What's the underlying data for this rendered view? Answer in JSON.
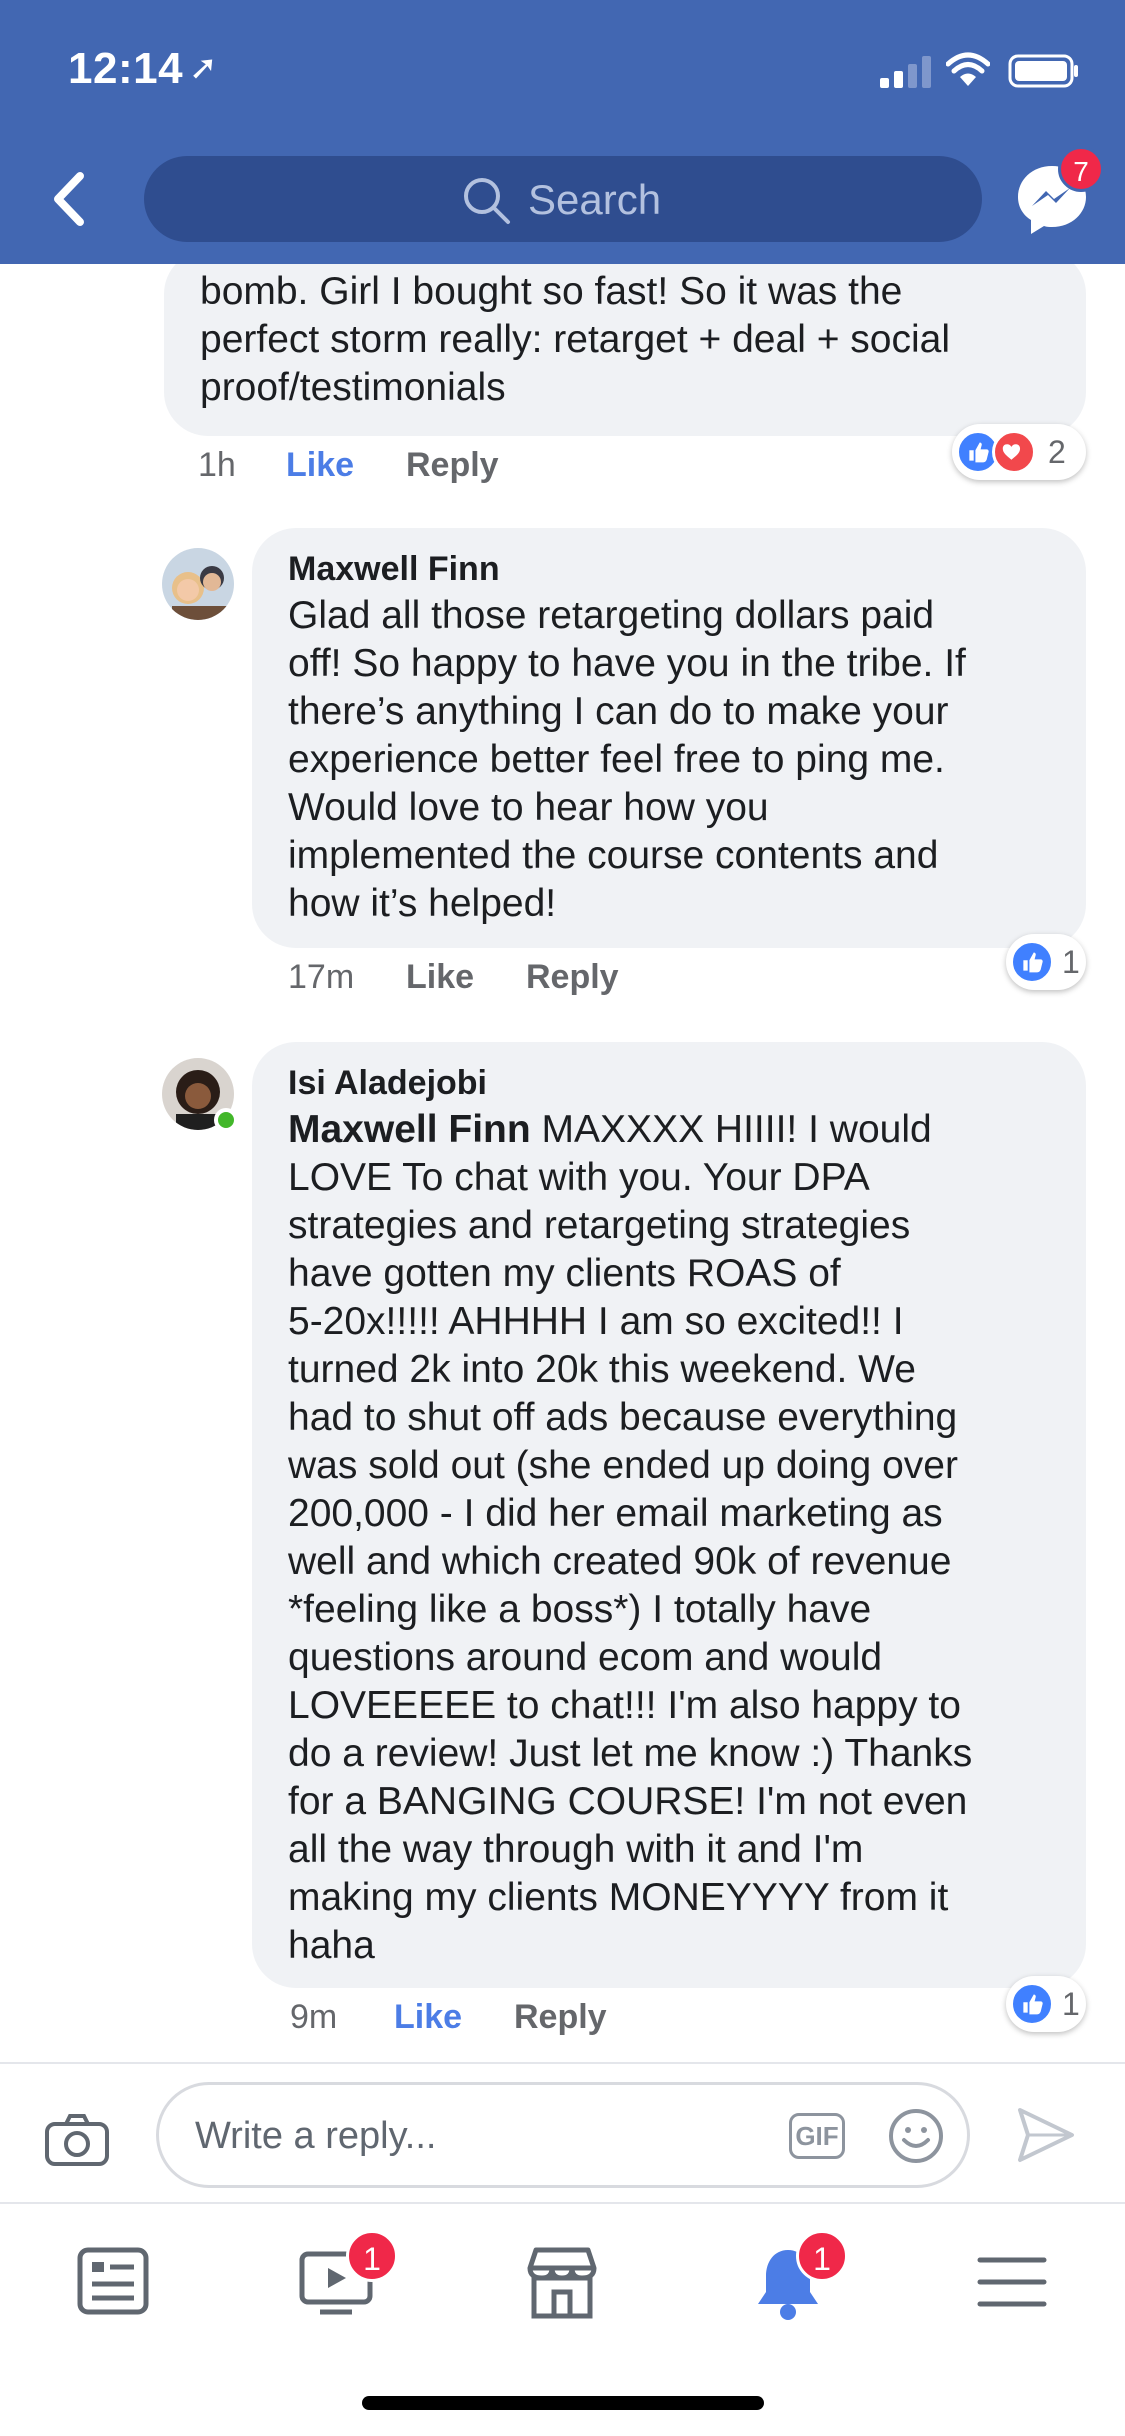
{
  "status": {
    "time": "12:14"
  },
  "header": {
    "search_placeholder": "Search",
    "messenger_badge": "7"
  },
  "comments": [
    {
      "text": "bomb. Girl I bought so fast! So it was the\nperfect storm really: retarget + deal + social\nproof/testimonials",
      "time": "1h",
      "like": "Like",
      "reply": "Reply",
      "reaction_count": "2"
    },
    {
      "name": "Maxwell Finn",
      "text": "Glad all those retargeting dollars paid\noff! So happy to have you in the tribe. If\nthere’s anything I can do to make your\nexperience better feel free to ping me.\nWould love to hear how you\nimplemented the course contents and\nhow it’s helped!",
      "time": "17m",
      "like": "Like",
      "reply": "Reply",
      "reaction_count": "1"
    },
    {
      "name": "Isi Aladejobi",
      "mention": "Maxwell Finn",
      "text_first_line": " MAXXXX HIIII! I would",
      "text": "LOVE To chat with you. Your DPA\nstrategies and retargeting strategies\nhave gotten my clients ROAS of\n5-20x!!!!! AHHHH I am so excited!! I\nturned 2k into 20k this weekend. We\nhad to shut off ads because everything\nwas sold out (she ended up doing over\n200,000 - I did her email marketing as\nwell and which created 90k of revenue\n*feeling like a boss*) I totally have\nquestions around ecom and would\nLOVEEEEE to chat!!! I'm also happy to\ndo a review! Just let me know :) Thanks\nfor a BANGING COURSE! I'm not even\nall the way through with it and I'm\nmaking my clients MONEYYYY from it\nhaha",
      "time": "9m",
      "like": "Like",
      "reply": "Reply",
      "reaction_count": "1"
    }
  ],
  "reply_bar": {
    "placeholder": "Write a reply...",
    "gif_label": "GIF"
  },
  "tabbar": {
    "video_badge": "1",
    "notifications_badge": "1"
  },
  "colors": {
    "brand": "#4267b2",
    "like_active": "#4c7de6",
    "badge": "#f02849"
  }
}
